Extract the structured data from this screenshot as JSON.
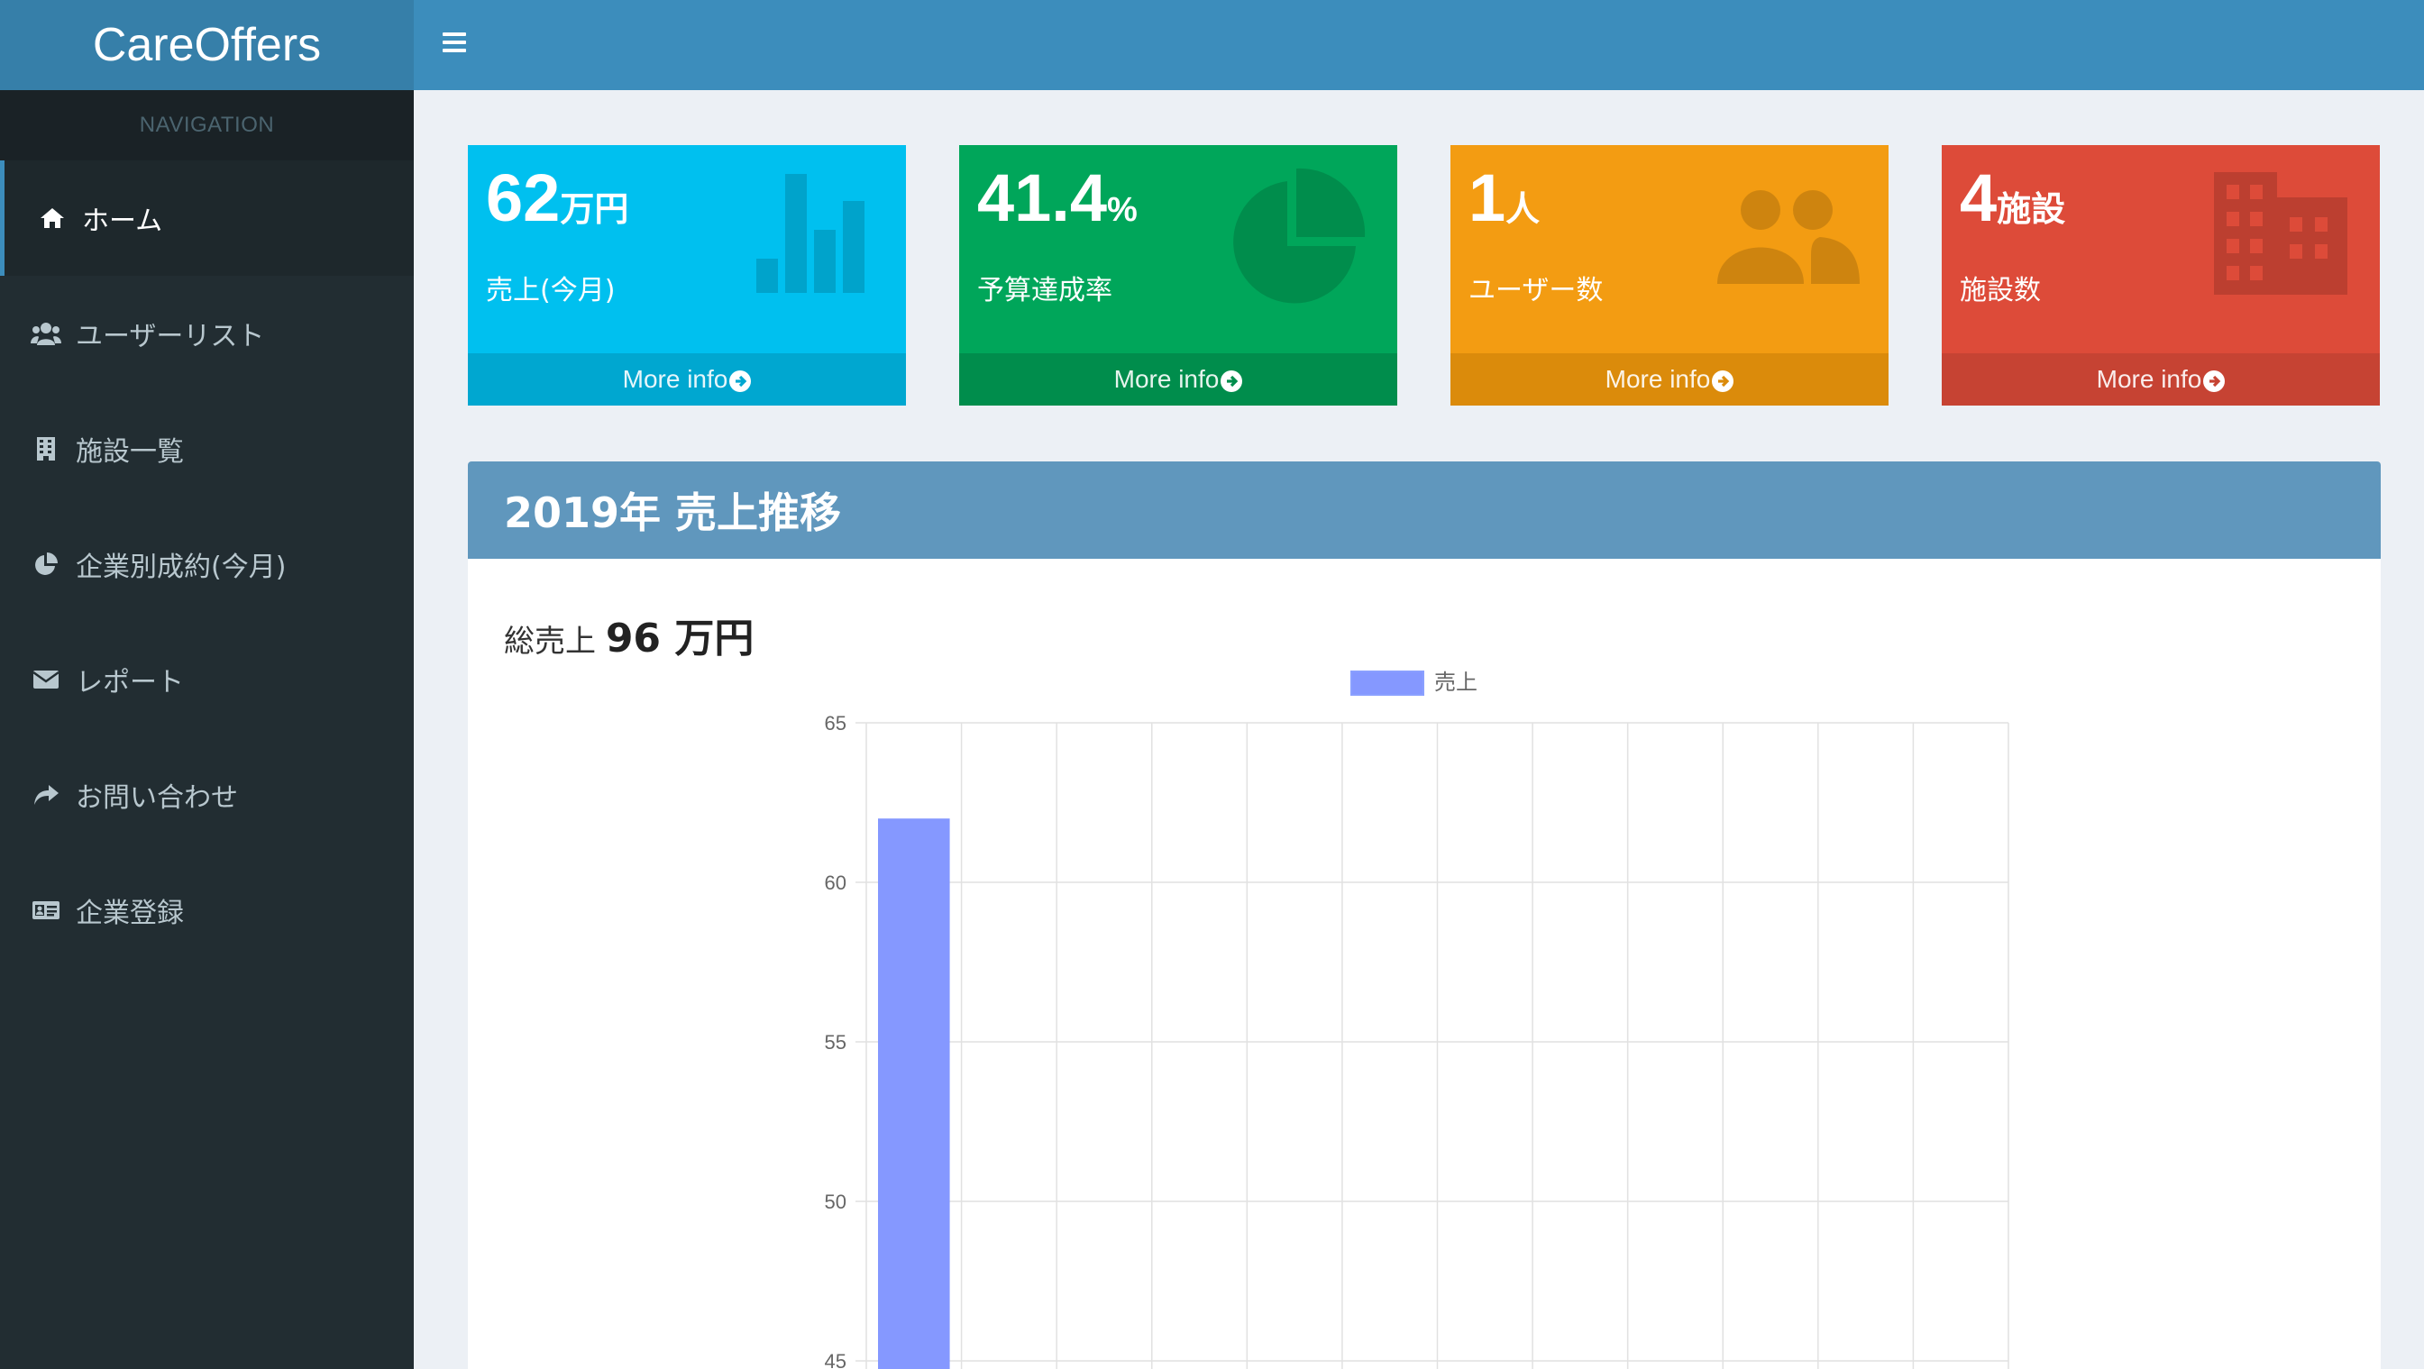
{
  "app": {
    "title": "CareOffers"
  },
  "sidebar": {
    "header": "NAVIGATION",
    "items": [
      {
        "label": "ホーム",
        "icon": "home-icon",
        "active": true
      },
      {
        "label": "ユーザーリスト",
        "icon": "users-icon"
      },
      {
        "label": "施設一覧",
        "icon": "building-icon"
      },
      {
        "label": "企業別成約(今月)",
        "icon": "pie-chart-icon"
      },
      {
        "label": "レポート",
        "icon": "envelope-icon"
      },
      {
        "label": "お問い合わせ",
        "icon": "share-icon"
      },
      {
        "label": "企業登録",
        "icon": "id-card-icon"
      }
    ]
  },
  "boxes": [
    {
      "value": "62",
      "unit": "万円",
      "label": "売上(今月)",
      "footer": "More info",
      "color": "#00c0ef",
      "footer_color": "#00a7d0",
      "icon": "bar-chart-icon"
    },
    {
      "value": "41.4",
      "unit": "%",
      "label": "予算達成率",
      "footer": "More info",
      "color": "#00a65a",
      "footer_color": "#008d4c",
      "icon": "pie-chart-icon"
    },
    {
      "value": "1",
      "unit": "人",
      "label": "ユーザー数",
      "footer": "More info",
      "color": "#f39c12",
      "footer_color": "#db8b0b",
      "icon": "users-icon"
    },
    {
      "value": "4",
      "unit": "施設",
      "label": "施設数",
      "footer": "More info",
      "color": "#dd4b39",
      "footer_color": "#c64333",
      "icon": "building-icon"
    }
  ],
  "panel": {
    "title": "2019年 売上推移",
    "total_prefix": "総売上",
    "total_value": "96 万円"
  },
  "chart_data": {
    "type": "bar",
    "categories": [
      "",
      "",
      "",
      "",
      "",
      "",
      "",
      "",
      "",
      "",
      "",
      ""
    ],
    "series": [
      {
        "name": "売上",
        "values": [
          62
        ],
        "color": "#8598ff"
      }
    ],
    "yticks": [
      65,
      60,
      55,
      50,
      45
    ],
    "ylim_visible": [
      45,
      65
    ],
    "grid": true,
    "legend": "top"
  }
}
